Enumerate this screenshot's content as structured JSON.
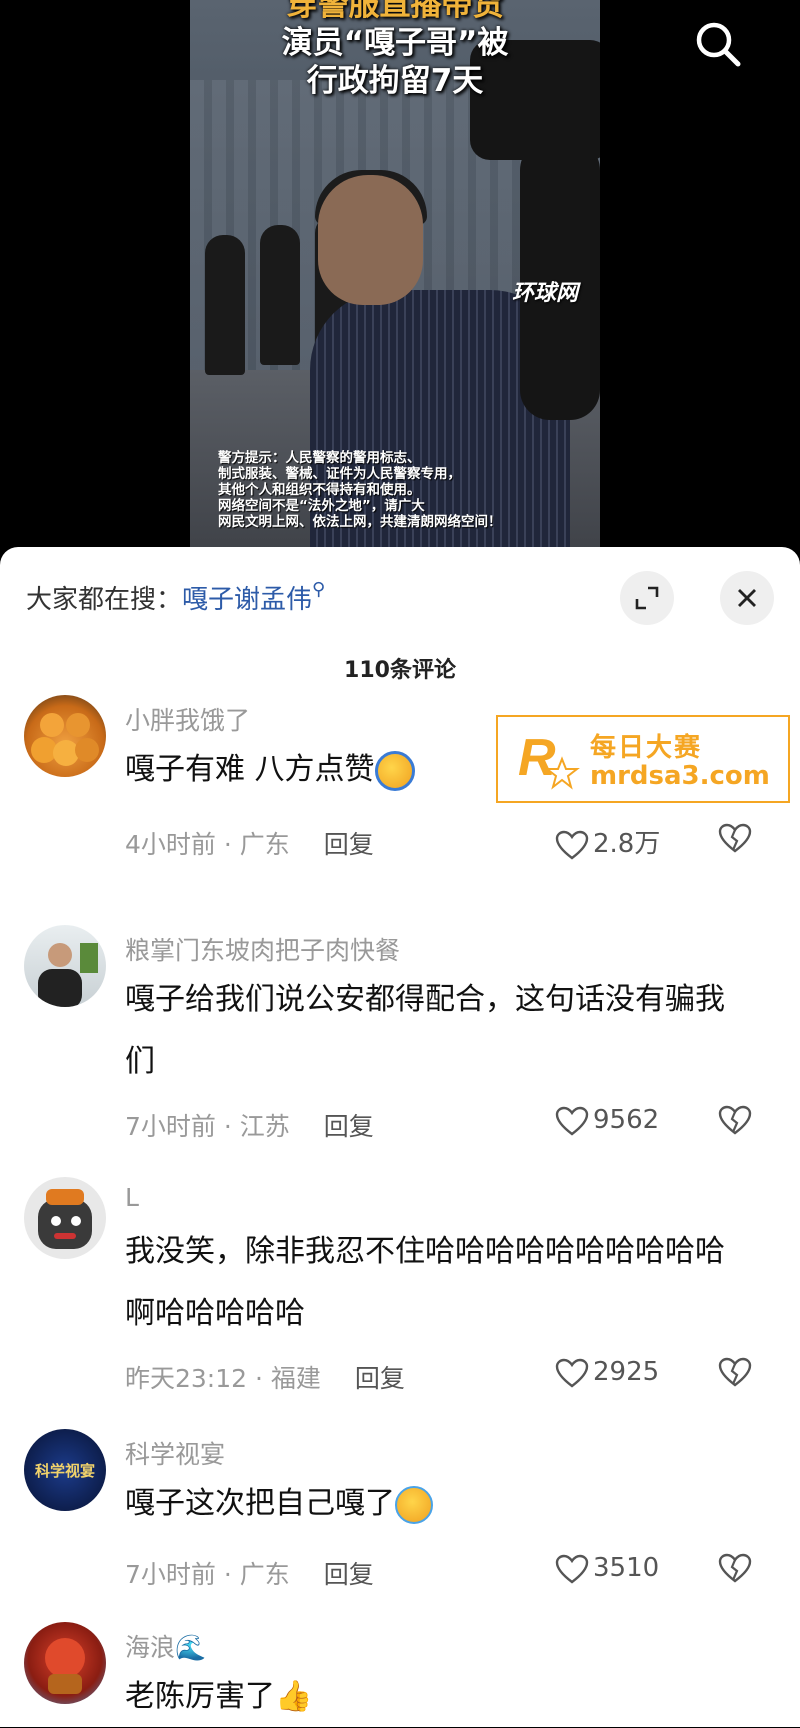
{
  "video": {
    "headline": [
      "穿警服直播带货",
      "演员“嘎子哥”被",
      "行政拘留7天"
    ],
    "source_watermark": "环球网",
    "police_note": [
      "警方提示：人民警察的警用标志、",
      "制式服装、警械、证件为人民警察专用，",
      "其他个人和组织不得持有和使用。",
      "网络空间不是“法外之地”，请广大",
      "网民文明上网、依法上网，共建清朗网络空间！"
    ]
  },
  "sheet": {
    "trending_prefix": "大家都在搜：",
    "trending_term": "嘎子谢孟伟",
    "comment_count": "110条评论"
  },
  "ad": {
    "brand": "每日大赛",
    "url": "mrdsa3.com"
  },
  "comments": [
    {
      "user": "小胖我饿了",
      "text": "嘎子有难 八方点赞",
      "time": "4小时前 · 广东",
      "reply": "回复",
      "likes": "2.8万"
    },
    {
      "user": "粮掌门东坡肉把子肉快餐",
      "text": "嘎子给我们说公安都得配合，这句话没有骗我们",
      "time": "7小时前 · 江苏",
      "reply": "回复",
      "likes": "9562"
    },
    {
      "user": "L",
      "text": "我没笑，除非我忍不住哈哈哈哈哈哈哈哈哈哈啊哈哈哈哈哈",
      "time": "昨天23:12 · 福建",
      "reply": "回复",
      "likes": "2925"
    },
    {
      "user": "科学视宴",
      "text": "嘎子这次把自己嘎了",
      "time": "7小时前 · 广东",
      "reply": "回复",
      "likes": "3510",
      "avatar_text": "科学视宴"
    },
    {
      "user": "海浪🌊",
      "text": "老陈厉害了",
      "time": "",
      "reply": "",
      "likes": ""
    }
  ],
  "colors": {
    "link_blue": "#2d5ba8",
    "ad_orange": "#f5a623",
    "meta_gray": "#999999"
  }
}
